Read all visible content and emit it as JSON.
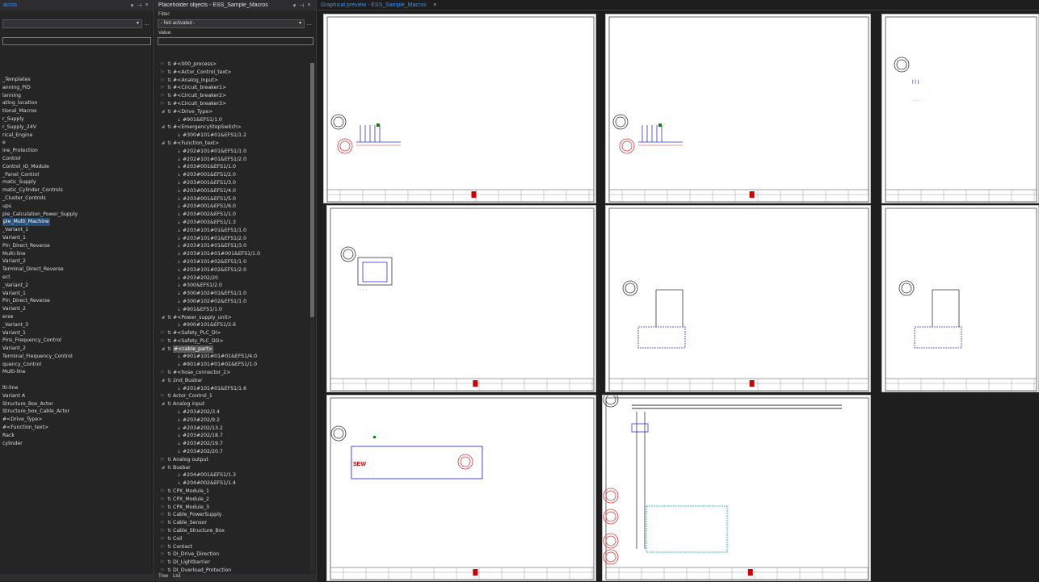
{
  "left_panel": {
    "title": "acros",
    "items": [
      "_Templates",
      "anning_PID",
      "lanning",
      "ating_location",
      "tional_Macros",
      "r_Supply",
      "r_Supply_24V",
      "rical_Engine",
      "e",
      "ine_Protection",
      "Control",
      "Control_IO_Module",
      "_Panel_Control",
      "matic_Supply",
      "matic_Cylinder_Controls",
      "_Cluster_Controls",
      "ups",
      "ple_Calculation_Power_Supply",
      "ple_Multi_Machine",
      "_Variant_1",
      "Variant_1",
      "Pin_Direct_Reverse",
      "Multi-line",
      "Variant_2",
      "Terminal_Direct_Reverse",
      "ect",
      "_Variant_2",
      "Variant_1",
      "Pin_Direct_Reverse",
      "Variant_2",
      "erse",
      "_Variant_3",
      "Variant_1",
      "Pins_Frequency_Control",
      "Variant_2",
      "Terminal_Frequency_Control",
      "quency_Control",
      "Multi-line",
      "",
      "lti-line",
      "Variant A",
      "Structure_Box_Actor",
      "Structure_box_Cable_Actor",
      "#<Drive_Type>",
      "#<Function_text>",
      "Rack",
      "cylinder"
    ],
    "selected_index": 18
  },
  "mid_panel": {
    "title": "Placeholder objects - ESS_Sample_Macros",
    "filter_label": "Filter:",
    "filter_value": "- Not activated -",
    "value_label": "Value:",
    "items": [
      {
        "t": "#<000_process>",
        "d": 0,
        "e": "▷"
      },
      {
        "t": "#<Actor_Control_text>",
        "d": 0,
        "e": "▷"
      },
      {
        "t": "#<Analog_Input>",
        "d": 0,
        "e": "▷"
      },
      {
        "t": "#<Circuit_breaker1>",
        "d": 0,
        "e": "▷"
      },
      {
        "t": "#<Circuit_breaker2>",
        "d": 0,
        "e": "▷"
      },
      {
        "t": "#<Circuit_breaker3>",
        "d": 0,
        "e": "▷"
      },
      {
        "t": "#<Drive_Type>",
        "d": 0,
        "e": "◢"
      },
      {
        "t": "#901&EFS1/1.0",
        "d": 1,
        "e": ""
      },
      {
        "t": "#<EmergencyStopSwitch>",
        "d": 0,
        "e": "◢"
      },
      {
        "t": "#300#101#01&EFS1/1.2",
        "d": 1,
        "e": ""
      },
      {
        "t": "#<Function_text>",
        "d": 0,
        "e": "◢"
      },
      {
        "t": "#202#101#01&EFS1/1.0",
        "d": 1,
        "e": ""
      },
      {
        "t": "#202#101#01&EFS1/2.0",
        "d": 1,
        "e": ""
      },
      {
        "t": "#203#001&EFS1/1.0",
        "d": 1,
        "e": ""
      },
      {
        "t": "#203#001&EFS1/2.0",
        "d": 1,
        "e": ""
      },
      {
        "t": "#203#001&EFS1/3.0",
        "d": 1,
        "e": ""
      },
      {
        "t": "#203#001&EFS1/4.0",
        "d": 1,
        "e": ""
      },
      {
        "t": "#203#001&EFS1/5.0",
        "d": 1,
        "e": ""
      },
      {
        "t": "#203#001&EFS1/6.0",
        "d": 1,
        "e": ""
      },
      {
        "t": "#203#002&EFS1/1.0",
        "d": 1,
        "e": ""
      },
      {
        "t": "#203#003&EFS1/1.3",
        "d": 1,
        "e": ""
      },
      {
        "t": "#203#101#01&EFS1/1.0",
        "d": 1,
        "e": ""
      },
      {
        "t": "#203#101#01&EFS1/2.0",
        "d": 1,
        "e": ""
      },
      {
        "t": "#203#101#01&EFS1/3.0",
        "d": 1,
        "e": ""
      },
      {
        "t": "#203#101#01#001&EFS1/1.0",
        "d": 1,
        "e": ""
      },
      {
        "t": "#203#101#02&EFS1/1.0",
        "d": 1,
        "e": ""
      },
      {
        "t": "#203#101#02&EFS1/2.0",
        "d": 1,
        "e": ""
      },
      {
        "t": "#203#202/20",
        "d": 1,
        "e": ""
      },
      {
        "t": "#300&EFS1/2.0",
        "d": 1,
        "e": ""
      },
      {
        "t": "#300#102#01&EFS1/1.0",
        "d": 1,
        "e": ""
      },
      {
        "t": "#300#102#02&EFS1/1.0",
        "d": 1,
        "e": ""
      },
      {
        "t": "#901&EFS1/1.0",
        "d": 1,
        "e": ""
      },
      {
        "t": "#<Power_supply_unit>",
        "d": 0,
        "e": "◢"
      },
      {
        "t": "#900#101&EFS1/2.6",
        "d": 1,
        "e": ""
      },
      {
        "t": "#<Safety_PLC_DI>",
        "d": 0,
        "e": "▷"
      },
      {
        "t": "#<Safety_PLC_DO>",
        "d": 0,
        "e": "▷"
      },
      {
        "t": "#<cable_part>",
        "d": 0,
        "e": "◢",
        "hl": true
      },
      {
        "t": "#901#101#01#01&EFS1/4.0",
        "d": 1,
        "e": ""
      },
      {
        "t": "#901#101#01#02&EFS1/1.0",
        "d": 1,
        "e": ""
      },
      {
        "t": "#<hose_connector_2>",
        "d": 0,
        "e": "▷"
      },
      {
        "t": "2nd_Busbar",
        "d": 0,
        "e": "◢"
      },
      {
        "t": "#201#101#01&EFS1/1.6",
        "d": 1,
        "e": ""
      },
      {
        "t": "Actor_Control_1",
        "d": 0,
        "e": "▷"
      },
      {
        "t": "Analog input",
        "d": 0,
        "e": "◢"
      },
      {
        "t": "#203#202/3.4",
        "d": 1,
        "e": ""
      },
      {
        "t": "#203#202/9.2",
        "d": 1,
        "e": ""
      },
      {
        "t": "#203#202/13.2",
        "d": 1,
        "e": ""
      },
      {
        "t": "#203#202/18.7",
        "d": 1,
        "e": ""
      },
      {
        "t": "#203#202/19.7",
        "d": 1,
        "e": ""
      },
      {
        "t": "#203#202/20.7",
        "d": 1,
        "e": ""
      },
      {
        "t": "Analog output",
        "d": 0,
        "e": "▷"
      },
      {
        "t": "Busbar",
        "d": 0,
        "e": "◢"
      },
      {
        "t": "#204#001&EFS1/1.3",
        "d": 1,
        "e": ""
      },
      {
        "t": "#204#002&EFS1/1.4",
        "d": 1,
        "e": ""
      },
      {
        "t": "CPX_Module_1",
        "d": 0,
        "e": "▷"
      },
      {
        "t": "CPX_Module_2",
        "d": 0,
        "e": "▷"
      },
      {
        "t": "CPX_Module_3",
        "d": 0,
        "e": "▷"
      },
      {
        "t": "Cable_PowerSupply",
        "d": 0,
        "e": "▷"
      },
      {
        "t": "Cable_Sensor",
        "d": 0,
        "e": "▷"
      },
      {
        "t": "Cable_Structure_Box",
        "d": 0,
        "e": "▷"
      },
      {
        "t": "Coil",
        "d": 0,
        "e": "▷"
      },
      {
        "t": "Contact",
        "d": 0,
        "e": "▷"
      },
      {
        "t": "DI_Drive_Direction",
        "d": 0,
        "e": "▷"
      },
      {
        "t": "DI_Lightbarrier",
        "d": 0,
        "e": "▷"
      },
      {
        "t": "DI_Overload_Protection",
        "d": 0,
        "e": "▷"
      }
    ],
    "tab_tree": "Tree",
    "tab_list": "List"
  },
  "preview": {
    "title": "Graphical preview - ESS_Sample_Macros",
    "close": "×",
    "sew_label": "SEW"
  },
  "icons": {
    "dropdown": "▾",
    "pin": "ᵃ",
    "close": "×",
    "ellipsis": "..."
  }
}
